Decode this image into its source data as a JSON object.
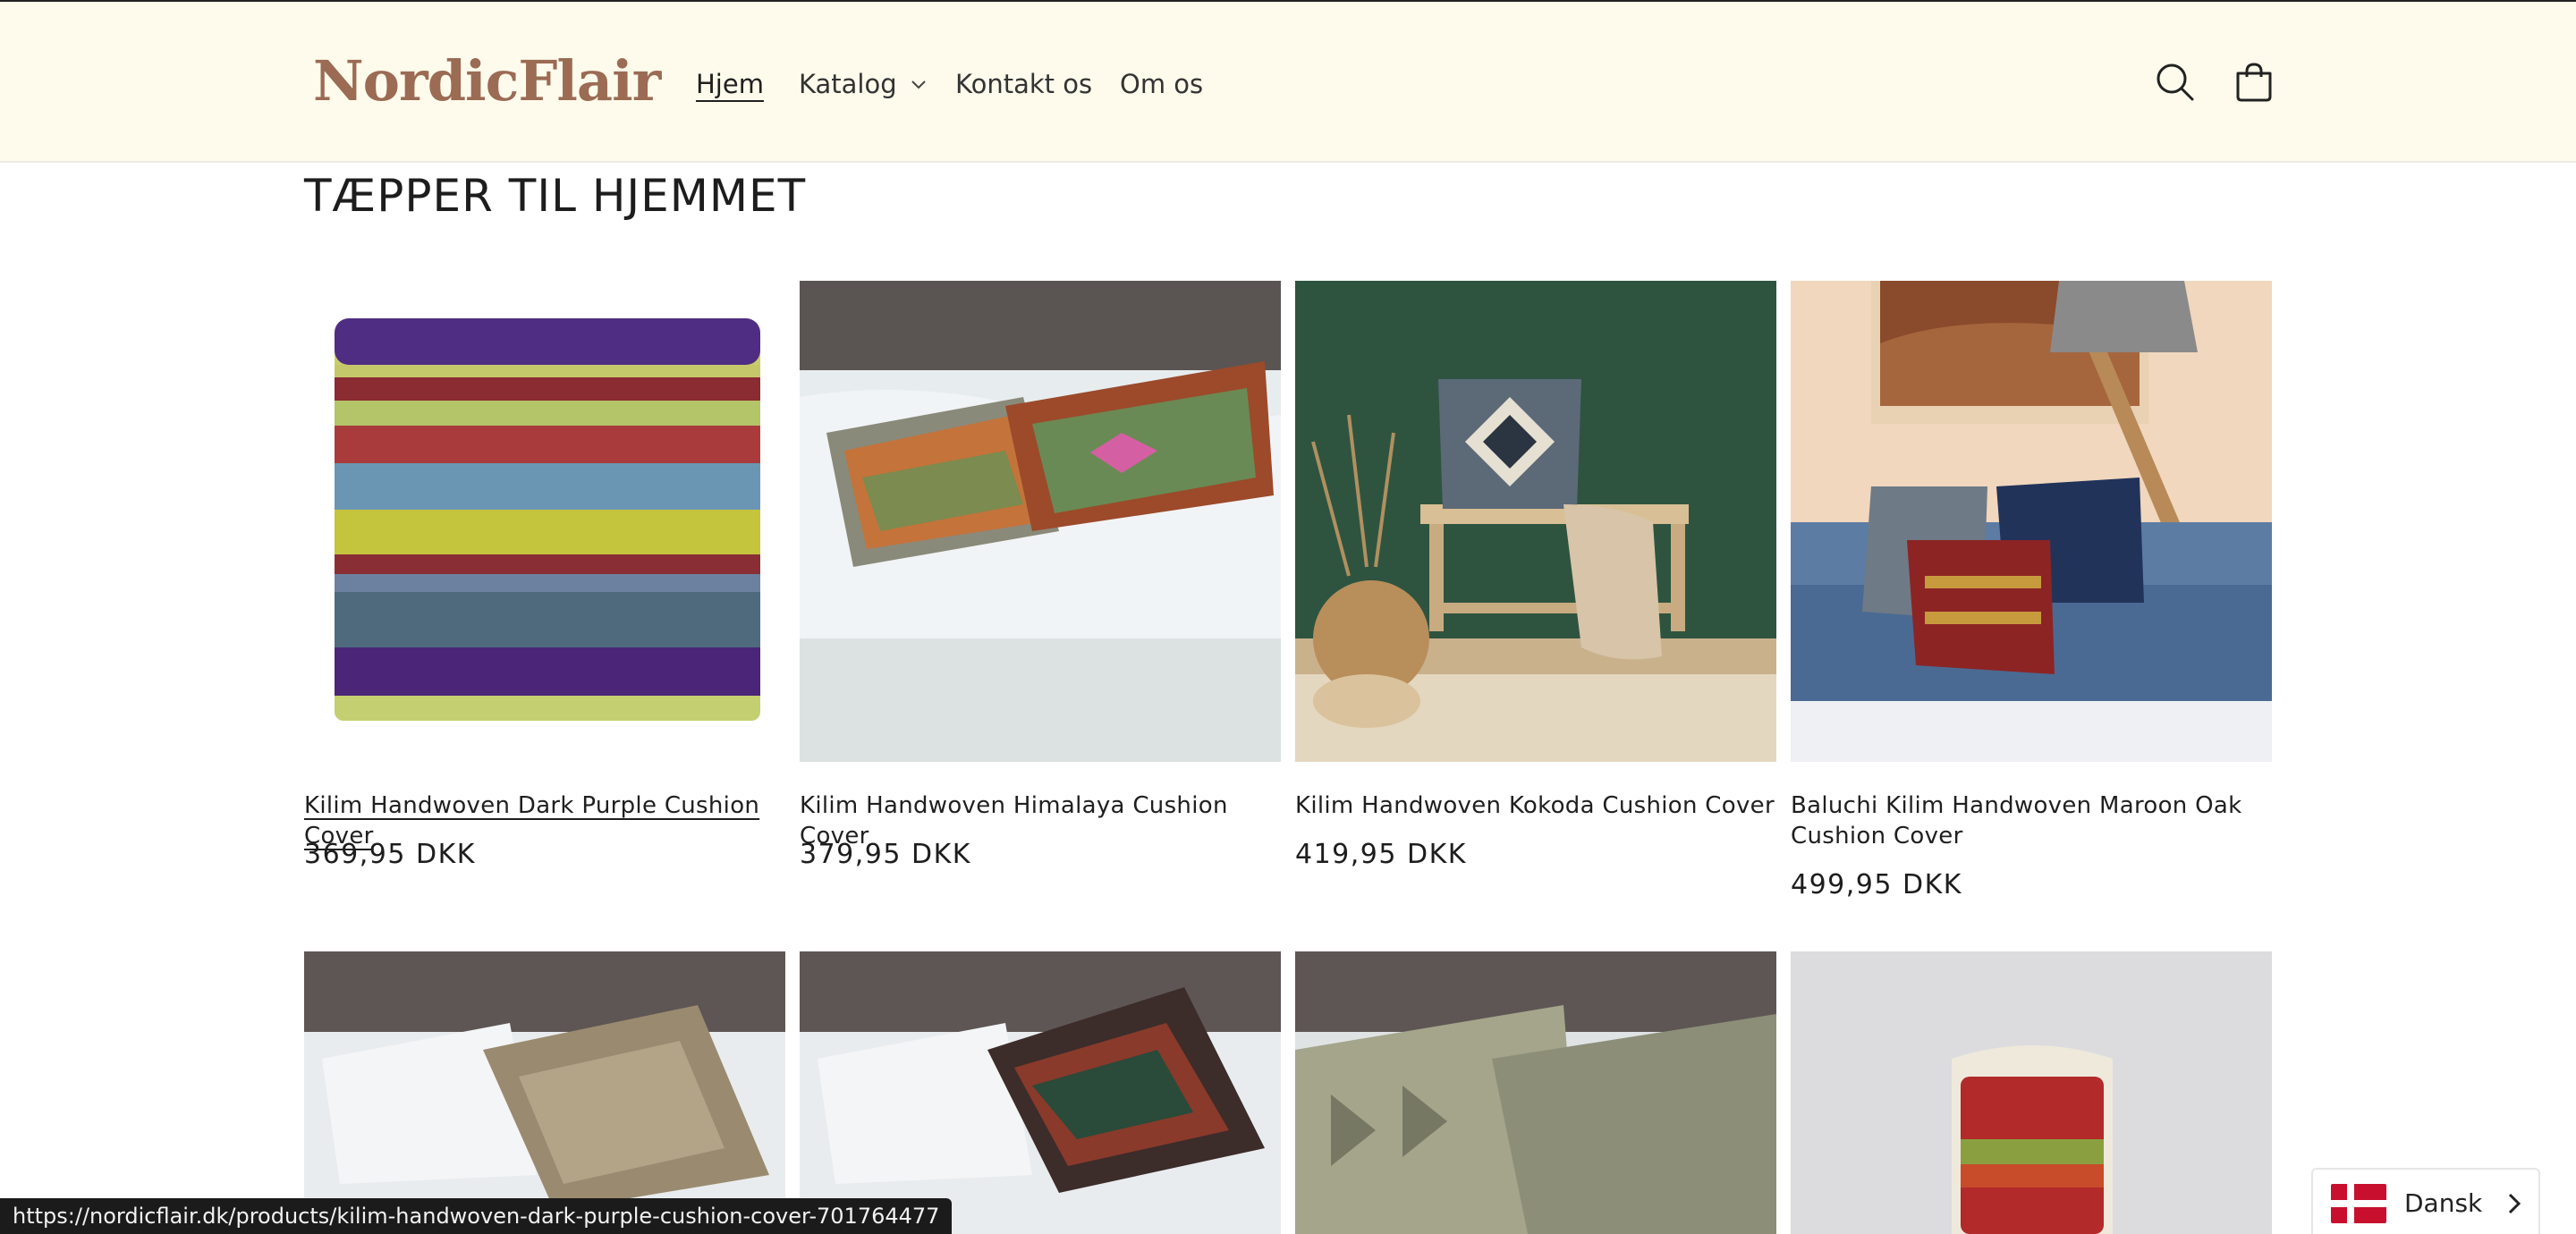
{
  "header": {
    "logo": "NordicFlair",
    "nav": {
      "home": "Hjem",
      "catalog": "Katalog",
      "contact": "Kontakt os",
      "about": "Om os"
    },
    "icons": {
      "search": "search-icon",
      "cart": "cart-icon",
      "catalog_dropdown": "chevron-down-icon"
    }
  },
  "collection": {
    "title": "TÆPPER TIL HJEMMET",
    "products": [
      {
        "title": "Kilim Handwoven Dark Purple Cushion Cover",
        "price": "369,95 DKK"
      },
      {
        "title": "Kilim Handwoven Himalaya Cushion Cover",
        "price": "379,95 DKK"
      },
      {
        "title": "Kilim Handwoven Kokoda Cushion Cover",
        "price": "419,95 DKK"
      },
      {
        "title": "Baluchi Kilim Handwoven Maroon Oak Cushion Cover",
        "price": "499,95 DKK"
      }
    ]
  },
  "status_bar": {
    "url": "https://nordicflair.dk/products/kilim-handwoven-dark-purple-cushion-cover-701764477"
  },
  "language": {
    "label": "Dansk",
    "flag": "danish-flag-icon"
  },
  "colors": {
    "header_bg": "#fefbec",
    "logo": "#9b6b54",
    "flag_red": "#c8102e"
  }
}
